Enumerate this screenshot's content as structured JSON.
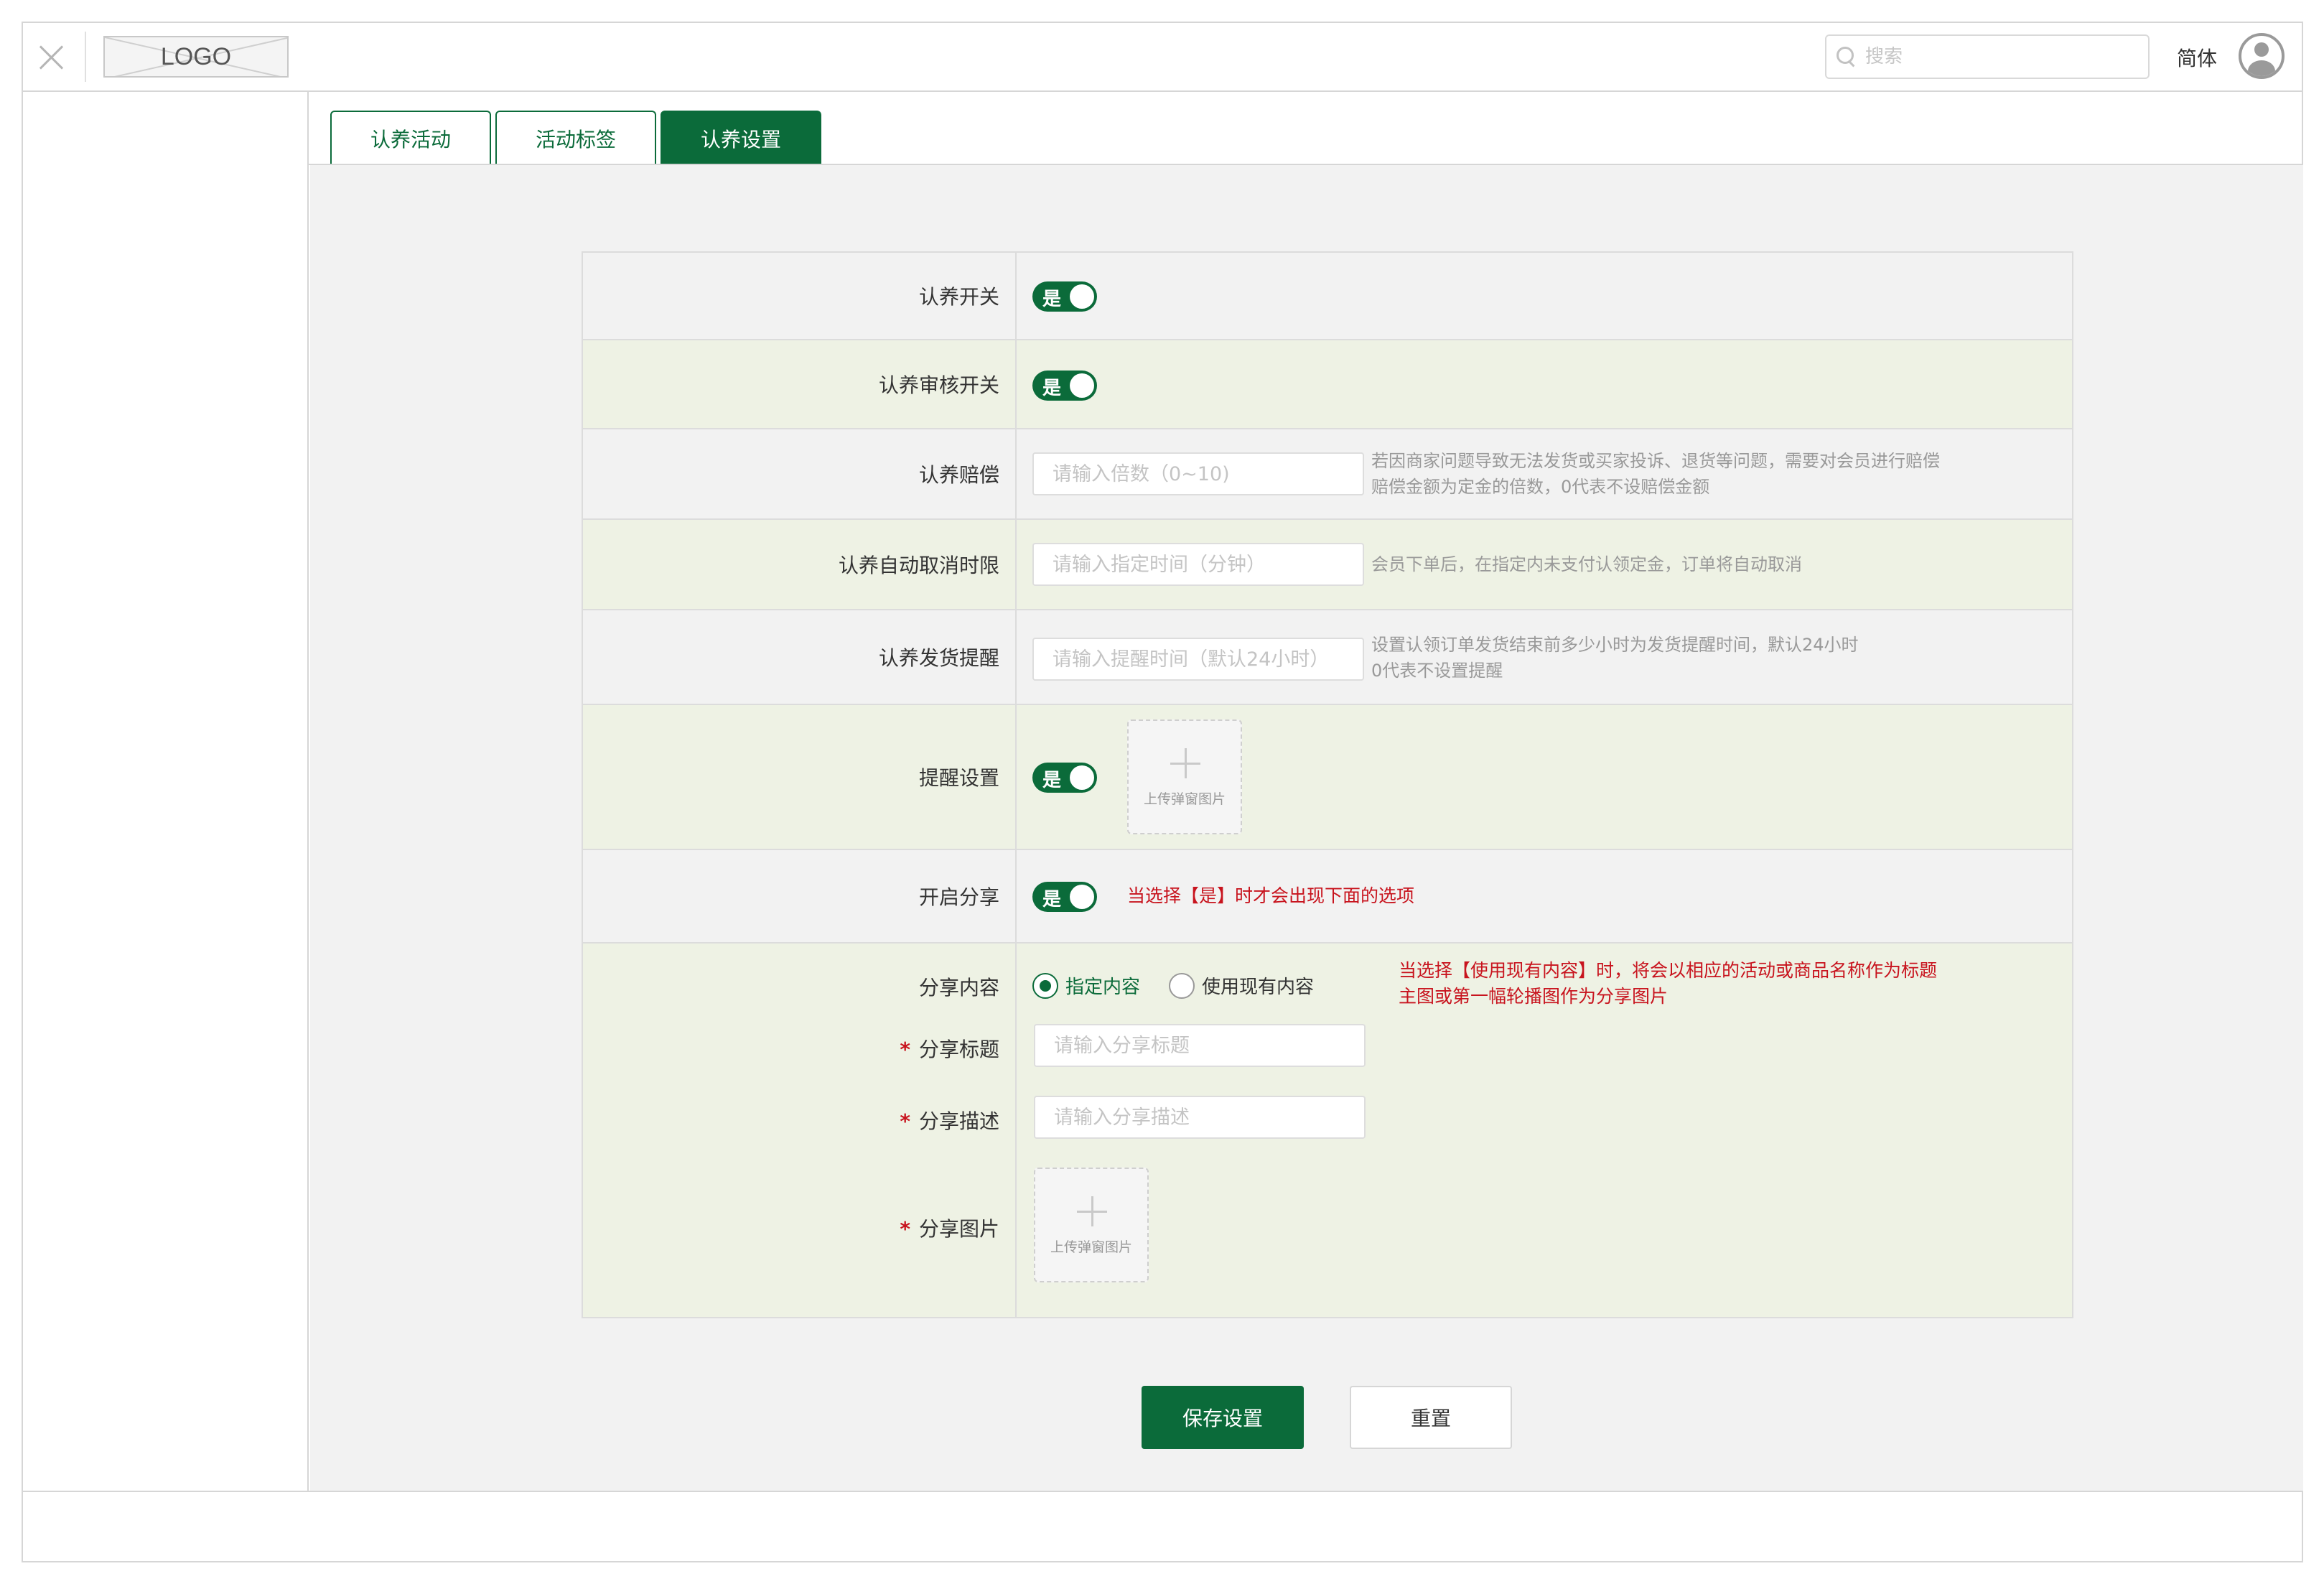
{
  "header": {
    "logo_text": "LOGO",
    "search_placeholder": "搜索",
    "language": "简体"
  },
  "tabs": [
    {
      "label": "认养活动",
      "active": false
    },
    {
      "label": "活动标签",
      "active": false
    },
    {
      "label": "认养设置",
      "active": true
    }
  ],
  "form": {
    "adopt_switch": {
      "label": "认养开关",
      "toggle_text": "是",
      "on": true
    },
    "audit_switch": {
      "label": "认养审核开关",
      "toggle_text": "是",
      "on": true
    },
    "compensation": {
      "label": "认养赔偿",
      "placeholder": "请输入倍数（0~10)",
      "hint_line1": "若因商家问题导致无法发货或买家投诉、退货等问题，需要对会员进行赔偿",
      "hint_line2": "赔偿金额为定金的倍数，0代表不设赔偿金额"
    },
    "auto_cancel": {
      "label": "认养自动取消时限",
      "placeholder": "请输入指定时间（分钟）",
      "hint": "会员下单后，在指定内未支付认领定金，订单将自动取消"
    },
    "ship_reminder": {
      "label": "认养发货提醒",
      "placeholder": "请输入提醒时间（默认24小时）",
      "hint_line1": "设置认领订单发货结束前多少小时为发货提醒时间，默认24小时",
      "hint_line2": "0代表不设置提醒"
    },
    "reminder_setting": {
      "label": "提醒设置",
      "toggle_text": "是",
      "on": true,
      "upload_text": "上传弹窗图片"
    },
    "share_enable": {
      "label": "开启分享",
      "toggle_text": "是",
      "on": true,
      "note": "当选择【是】时才会出现下面的选项"
    },
    "share": {
      "content_label": "分享内容",
      "options": [
        {
          "label": "指定内容",
          "checked": true
        },
        {
          "label": "使用现有内容",
          "checked": false
        }
      ],
      "note_line1": "当选择【使用现有内容】时，将会以相应的活动或商品名称作为标题",
      "note_line2": "主图或第一幅轮播图作为分享图片",
      "required_mark": "*",
      "title_label": "分享标题",
      "title_placeholder": "请输入分享标题",
      "desc_label": "分享描述",
      "desc_placeholder": "请输入分享描述",
      "image_label": "分享图片",
      "upload_text": "上传弹窗图片"
    }
  },
  "buttons": {
    "save": "保存设置",
    "reset": "重置"
  },
  "colors": {
    "primary": "#0b6b3a",
    "alert": "#c8141e",
    "alt_row": "#eef2e4"
  }
}
